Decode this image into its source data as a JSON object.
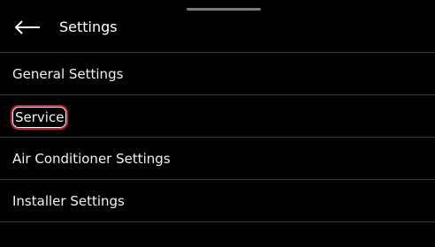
{
  "header": {
    "back_icon": "arrow-left-icon",
    "title": "Settings"
  },
  "menu": {
    "items": [
      {
        "label": "General Settings"
      },
      {
        "label": "Service",
        "highlighted": true
      },
      {
        "label": "Air Conditioner Settings"
      },
      {
        "label": "Installer Settings"
      }
    ]
  },
  "colors": {
    "background": "#000000",
    "text": "#ffffff",
    "divider": "#3a3a3a",
    "highlight_outline": "#c81f3a"
  }
}
